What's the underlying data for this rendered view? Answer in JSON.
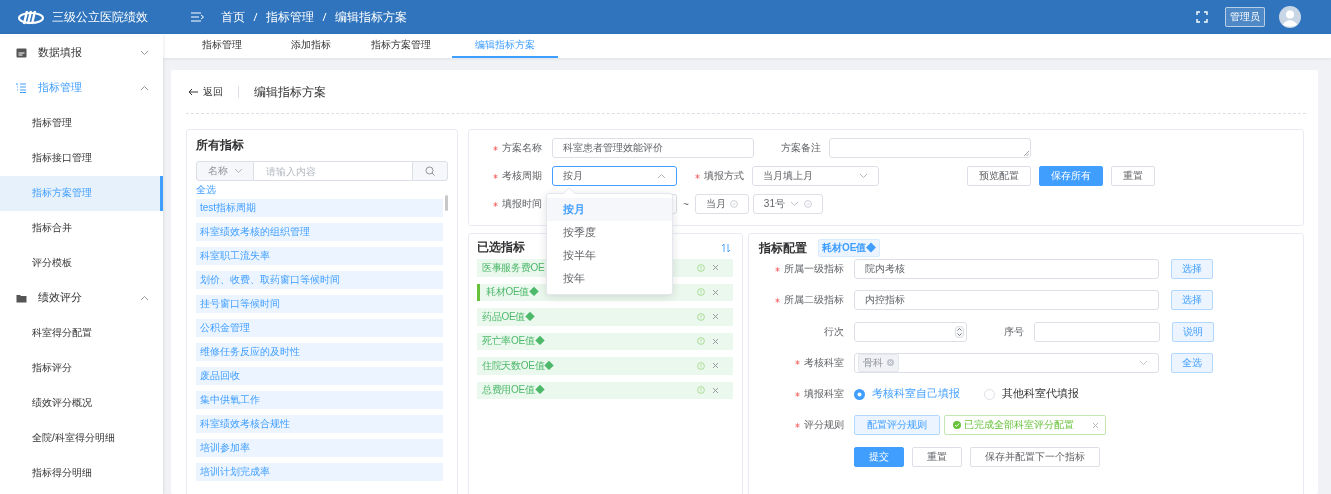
{
  "header": {
    "title": "三级公立医院绩效",
    "breadcrumb": [
      "首页",
      "指标管理",
      "编辑指标方案"
    ],
    "user_badge": "管理员"
  },
  "sidebar": {
    "groups": [
      {
        "label": "数据填报",
        "expanded": false
      },
      {
        "label": "指标管理",
        "expanded": true,
        "children": [
          {
            "label": "指标管理",
            "selected": false
          },
          {
            "label": "指标接口管理",
            "selected": false
          },
          {
            "label": "指标方案管理",
            "selected": true
          },
          {
            "label": "指标合并",
            "selected": false
          },
          {
            "label": "评分模板",
            "selected": false
          }
        ]
      },
      {
        "label": "绩效评分",
        "expanded": true,
        "children": [
          {
            "label": "科室得分配置",
            "selected": false
          },
          {
            "label": "指标评分",
            "selected": false
          },
          {
            "label": "绩效评分概况",
            "selected": false
          },
          {
            "label": "全院/科室得分明细",
            "selected": false
          },
          {
            "label": "指标得分明细",
            "selected": false
          }
        ]
      }
    ]
  },
  "tabs": [
    {
      "label": "指标管理",
      "selected": false
    },
    {
      "label": "添加指标",
      "selected": false
    },
    {
      "label": "指标方案管理",
      "selected": false
    },
    {
      "label": "编辑指标方案",
      "selected": true
    }
  ],
  "page": {
    "back": "返回",
    "title": "编辑指标方案"
  },
  "all_indicators": {
    "title": "所有指标",
    "filter_select": "名称",
    "search": {
      "placeholder": "请输入内容"
    },
    "select_all": "全选",
    "items": [
      "test指标周期",
      "科室绩效考核的组织管理",
      "科室职工流失率",
      "划价、收费、取药窗口等候时间",
      "挂号窗口等候时间",
      "公积金管理",
      "维修任务反应的及时性",
      "废品回收",
      "集中供氧工作",
      "科室绩效考核合规性",
      "培训参加率",
      "培训计划完成率"
    ]
  },
  "scheme_form": {
    "name": {
      "label": "方案名称",
      "required": true,
      "value": "科室患者管理效能评价"
    },
    "remark": {
      "label": "方案备注",
      "required": false
    },
    "period": {
      "label": "考核周期",
      "required": true,
      "value": "按月",
      "open": true,
      "options": [
        {
          "label": "按月",
          "selected": true
        },
        {
          "label": "按季度",
          "selected": false
        },
        {
          "label": "按半年",
          "selected": false
        },
        {
          "label": "按年",
          "selected": false
        }
      ]
    },
    "fill_method": {
      "label": "填报方式",
      "required": true,
      "value": "当月填上月"
    },
    "fill_time": {
      "label": "填报时间",
      "required": true,
      "separator": "~",
      "end_month": "当月",
      "end_day": "31号"
    },
    "buttons": [
      {
        "label": "预览配置",
        "primary": false
      },
      {
        "label": "保存所有",
        "primary": true
      },
      {
        "label": "重置",
        "primary": false
      }
    ]
  },
  "selected_indicators": {
    "title": "已选指标",
    "items": [
      {
        "label": "医事服务费OE",
        "selected": false
      },
      {
        "label": "耗材OE值◆",
        "selected": true
      },
      {
        "label": "药品OE值◆",
        "selected": false
      },
      {
        "label": "死亡率OE值◆",
        "selected": false
      },
      {
        "label": "住院天数OE值◆",
        "selected": false
      },
      {
        "label": "总费用OE值◆",
        "selected": false
      }
    ]
  },
  "config": {
    "title": "指标配置",
    "tag": "耗材OE值◆",
    "rows": [
      {
        "kind": "text",
        "label": "所属一级指标",
        "required": true,
        "value": "院内考核",
        "button": "选择"
      },
      {
        "kind": "text",
        "label": "所属二级指标",
        "required": true,
        "value": "内控指标",
        "button": "选择"
      },
      {
        "kind": "pair",
        "label": "行次",
        "required": false,
        "label_2": "序号",
        "button": "说明"
      },
      {
        "kind": "tags",
        "label": "考核科室",
        "required": true,
        "tags": [
          "骨科"
        ],
        "button": "全选"
      },
      {
        "kind": "radio",
        "label": "填报科室",
        "required": true,
        "options": [
          {
            "label": "考核科室自己填报",
            "selected": true
          },
          {
            "label": "其他科室代填报",
            "selected": false
          }
        ]
      },
      {
        "kind": "rule",
        "label": "评分规则",
        "required": true,
        "button": "配置评分规则",
        "status": "已完成全部科室评分配置"
      }
    ],
    "buttons": [
      {
        "label": "提交",
        "primary": true
      },
      {
        "label": "重置",
        "primary": false
      },
      {
        "label": "保存并配置下一个指标",
        "primary": false
      }
    ]
  }
}
